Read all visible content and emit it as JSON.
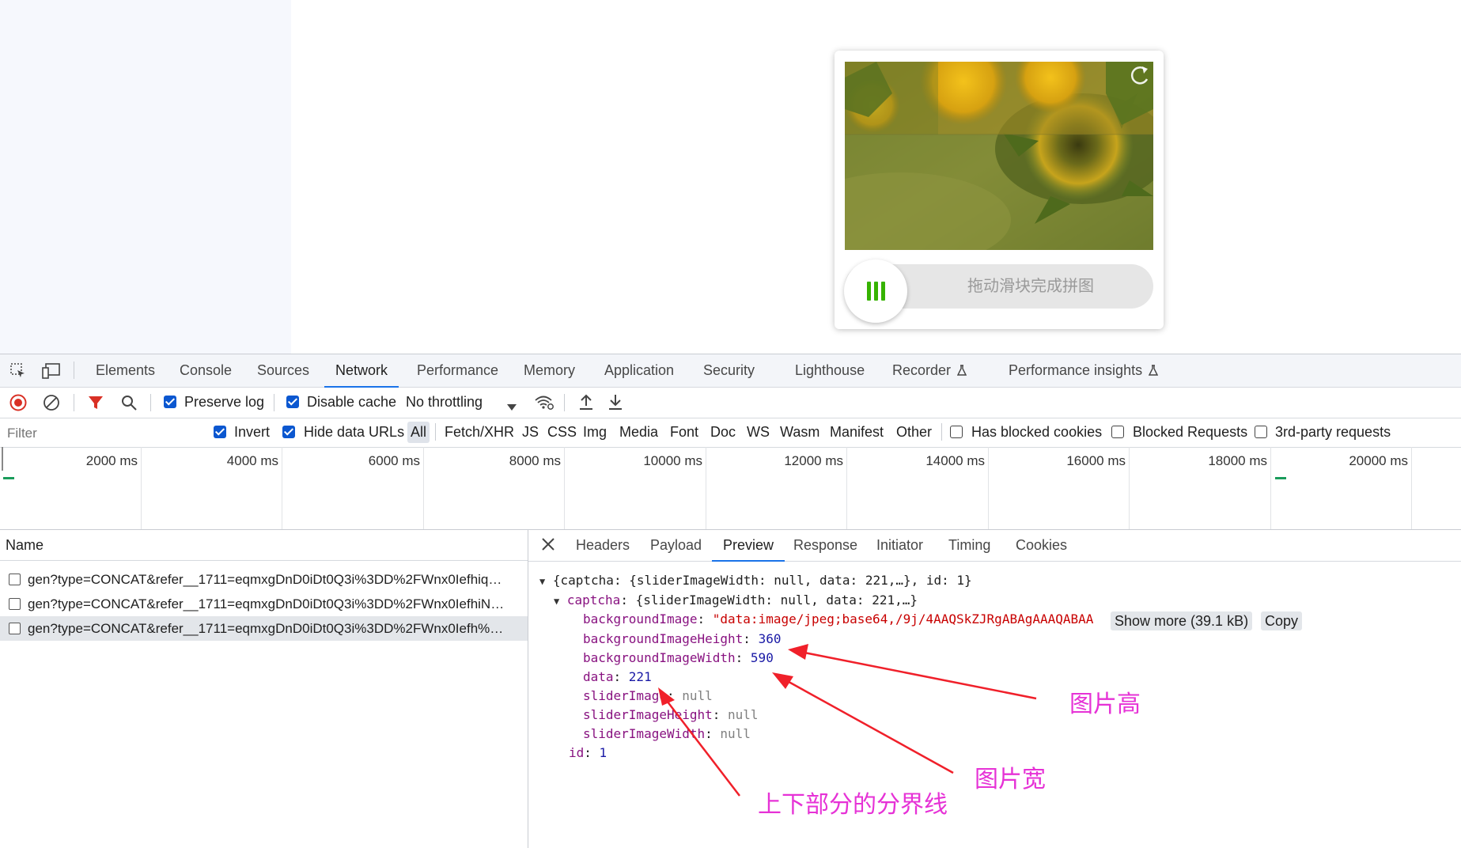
{
  "captcha": {
    "slider_text": "拖动滑块完成拼图"
  },
  "devtools": {
    "tabs": [
      "Elements",
      "Console",
      "Sources",
      "Network",
      "Performance",
      "Memory",
      "Application",
      "Security",
      "Lighthouse",
      "Recorder",
      "Performance insights"
    ],
    "active_tab": "Network",
    "toolbar": {
      "preserve_log": "Preserve log",
      "disable_cache": "Disable cache",
      "throttling": "No throttling"
    },
    "filter": {
      "placeholder": "Filter",
      "invert": "Invert",
      "hide_data_urls": "Hide data URLs",
      "types": [
        "All",
        "Fetch/XHR",
        "JS",
        "CSS",
        "Img",
        "Media",
        "Font",
        "Doc",
        "WS",
        "Wasm",
        "Manifest",
        "Other"
      ],
      "has_blocked_cookies": "Has blocked cookies",
      "blocked_requests": "Blocked Requests",
      "third_party": "3rd-party requests"
    },
    "timeline_ticks": [
      "2000 ms",
      "4000 ms",
      "6000 ms",
      "8000 ms",
      "10000 ms",
      "12000 ms",
      "14000 ms",
      "16000 ms",
      "18000 ms",
      "20000 ms"
    ],
    "requests": {
      "header": "Name",
      "rows": [
        "gen?type=CONCAT&refer__1711=eqmxgDnD0iDt0Q3i%3DD%2FWnx0Iefhiq…",
        "gen?type=CONCAT&refer__1711=eqmxgDnD0iDt0Q3i%3DD%2FWnx0IefhiN…",
        "gen?type=CONCAT&refer__1711=eqmxgDnD0iDt0Q3i%3DD%2FWnx0Iefh%…"
      ]
    },
    "detail_tabs": [
      "Headers",
      "Payload",
      "Preview",
      "Response",
      "Initiator",
      "Timing",
      "Cookies"
    ],
    "active_detail_tab": "Preview",
    "preview": {
      "root_summary": "{captcha: {sliderImageWidth: null, data: 221,…}, id: 1}",
      "captcha_key": "captcha",
      "captcha_summary": "{sliderImageWidth: null, data: 221,…}",
      "fields": {
        "backgroundImage_key": "backgroundImage",
        "backgroundImage_val": "\"data:image/jpeg;base64,/9j/4AAQSkZJRgABAgAAAQABAA",
        "show_more": "Show more (39.1 kB)",
        "copy": "Copy",
        "backgroundImageHeight_key": "backgroundImageHeight",
        "backgroundImageHeight_val": "360",
        "backgroundImageWidth_key": "backgroundImageWidth",
        "backgroundImageWidth_val": "590",
        "data_key": "data",
        "data_val": "221",
        "sliderImage_key": "sliderImage",
        "sliderImage_val": "null",
        "sliderImageHeight_key": "sliderImageHeight",
        "sliderImageHeight_val": "null",
        "sliderImageWidth_key": "sliderImageWidth",
        "sliderImageWidth_val": "null",
        "id_key": "id",
        "id_val": "1"
      }
    }
  },
  "annotations": {
    "height_label": "图片高",
    "width_label": "图片宽",
    "boundary_label": "上下部分的分界线",
    "color": "#e632d6",
    "arrow_color": "#f0202a"
  }
}
